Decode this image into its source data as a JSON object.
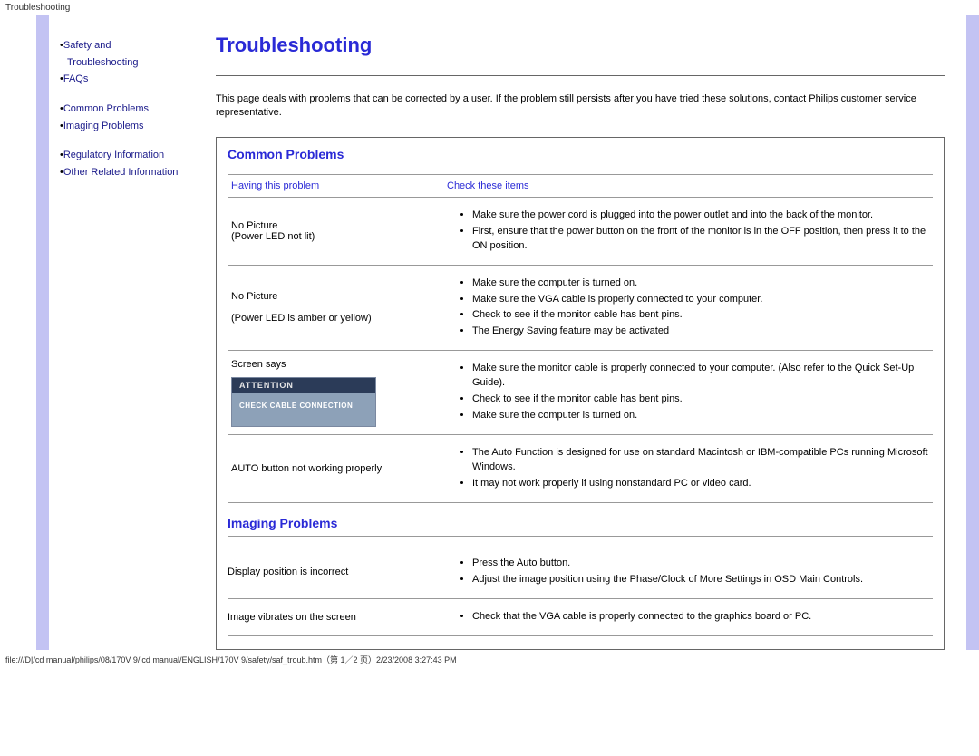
{
  "header_text": "Troubleshooting",
  "footer_text": "file:///D|/cd manual/philips/08/170V 9/lcd manual/ENGLISH/170V 9/safety/saf_troub.htm（第 1／2 页）2/23/2008 3:27:43 PM",
  "sidebar": {
    "group1": {
      "item0a": "Safety and",
      "item0b": "Troubleshooting",
      "item1": "FAQs"
    },
    "group2": {
      "item0": "Common Problems",
      "item1": "Imaging Problems"
    },
    "group3": {
      "item0": "Regulatory Information",
      "item1": "Other Related Information"
    }
  },
  "title": "Troubleshooting",
  "intro": "This page deals with problems that can be corrected by a user. If the problem still persists after you have tried these solutions, contact Philips customer service representative.",
  "common": {
    "heading": "Common Problems",
    "col_left": "Having this problem",
    "col_right": "Check these items",
    "rows": [
      {
        "problem_lines": [
          "No Picture",
          "(Power LED not lit)"
        ],
        "items": [
          "Make sure the power cord is plugged into the power outlet and into the back of the monitor.",
          "First, ensure that the power button on the front of the monitor is in the OFF position, then press it to the ON position."
        ]
      },
      {
        "problem_lines": [
          "No Picture",
          "",
          "(Power LED is amber or yellow)"
        ],
        "items": [
          "Make sure the computer is turned on.",
          "Make sure the VGA cable is properly connected to your computer.",
          "Check to see if the monitor cable has bent pins.",
          "The Energy Saving feature may be activated"
        ]
      },
      {
        "problem_lines": [
          "Screen says"
        ],
        "attention": {
          "hdr": "ATTENTION",
          "body": "CHECK CABLE CONNECTION"
        },
        "items": [
          "Make sure the monitor cable is properly connected to your computer. (Also refer to the Quick Set-Up Guide).",
          "Check to see if the monitor cable has bent pins.",
          "Make sure the computer is turned on."
        ]
      },
      {
        "problem_lines": [
          "AUTO button not working properly"
        ],
        "items": [
          "The Auto Function is designed for use on standard Macintosh or IBM-compatible PCs running Microsoft Windows.",
          "It may not work properly if using nonstandard PC or video card."
        ]
      }
    ]
  },
  "imaging": {
    "heading": "Imaging Problems",
    "rows": [
      {
        "problem": "Display position is incorrect",
        "items": [
          "Press the Auto button.",
          "Adjust the image position using the Phase/Clock of More Settings in OSD Main Controls."
        ]
      },
      {
        "problem": "Image vibrates on the screen",
        "items": [
          "Check that the VGA cable is properly connected to the graphics board or PC."
        ]
      }
    ]
  }
}
